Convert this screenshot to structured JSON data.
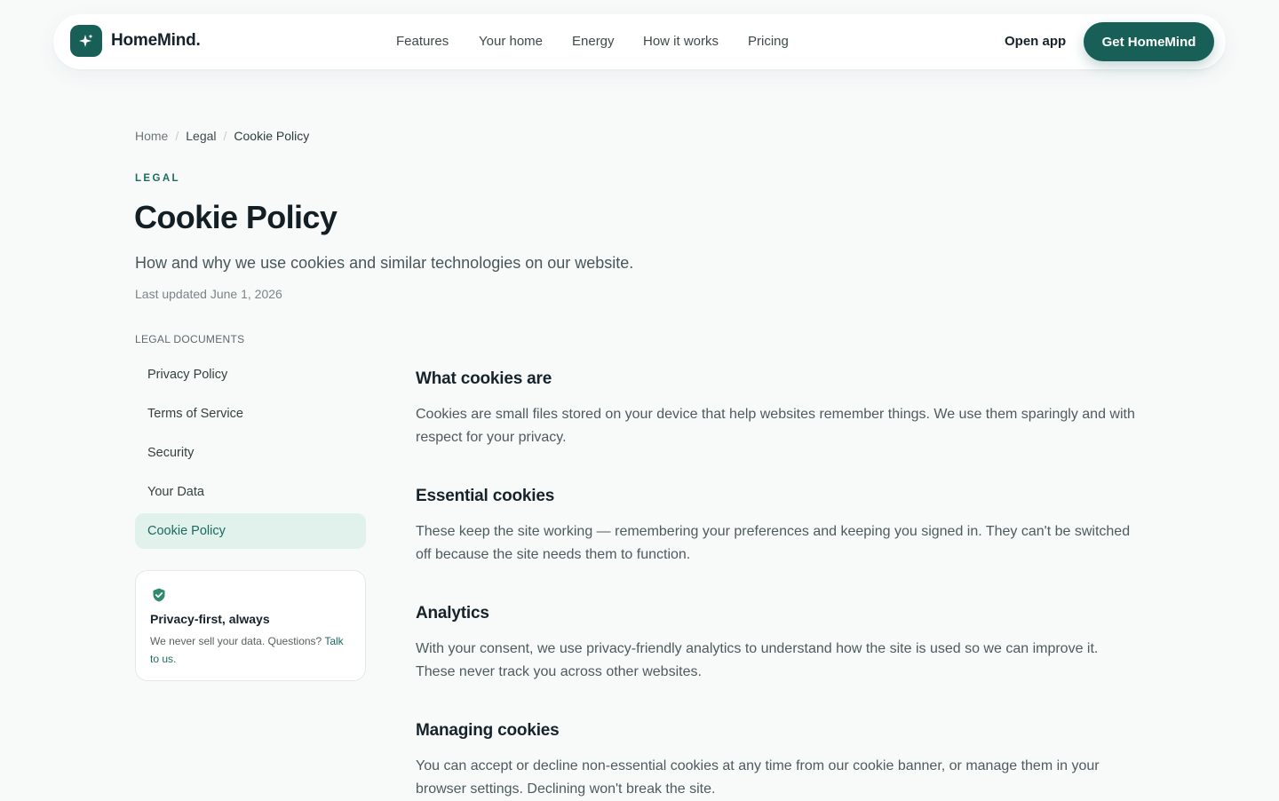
{
  "brand": {
    "name": "HomeMind.",
    "accent": "#175f57",
    "logo_icon": "sparkle-icon"
  },
  "nav": {
    "links": [
      "Features",
      "Your home",
      "Energy",
      "How it works",
      "Pricing"
    ],
    "open_app": "Open app",
    "cta": "Get HomeMind"
  },
  "breadcrumb": [
    "Home",
    "Legal",
    "Cookie Policy"
  ],
  "page": {
    "eyebrow": "LEGAL",
    "title": "Cookie Policy",
    "subtitle": "How and why we use cookies and similar technologies on our website.",
    "updated": "Last updated June 1, 2026"
  },
  "sidebar": {
    "heading": "LEGAL DOCUMENTS",
    "items": [
      {
        "label": "Privacy Policy",
        "active": false
      },
      {
        "label": "Terms of Service",
        "active": false
      },
      {
        "label": "Security",
        "active": false
      },
      {
        "label": "Your Data",
        "active": false
      },
      {
        "label": "Cookie Policy",
        "active": true
      }
    ],
    "card": {
      "icon": "shield-check-icon",
      "title": "Privacy-first, always",
      "body": "We never sell your data. Questions?",
      "link": "Talk to us",
      "link_end": "."
    }
  },
  "sections": [
    {
      "title": "What cookies are",
      "body": "Cookies are small files stored on your device that help websites remember things. We use them sparingly and with respect for your privacy."
    },
    {
      "title": "Essential cookies",
      "body": "These keep the site working — remembering your preferences and keeping you signed in. They can't be switched off because the site needs them to function."
    },
    {
      "title": "Analytics",
      "body": "With your consent, we use privacy-friendly analytics to understand how the site is used so we can improve it. These never track you across other websites."
    },
    {
      "title": "Managing cookies",
      "body": "You can accept or decline non-essential cookies at any time from our cookie banner, or manage them in your browser settings. Declining won't break the site."
    }
  ]
}
